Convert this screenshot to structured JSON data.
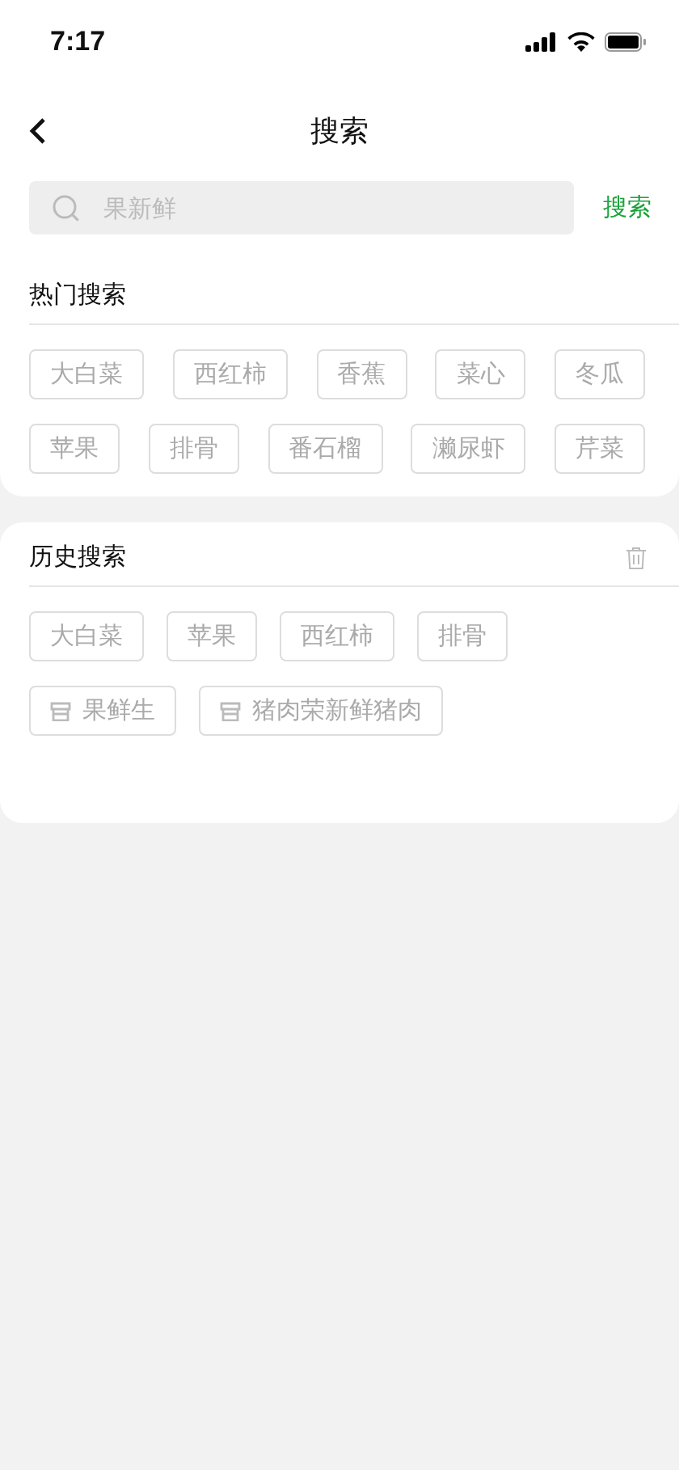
{
  "status_bar": {
    "time": "7:17"
  },
  "header": {
    "title": "搜索"
  },
  "search": {
    "placeholder": "果新鲜",
    "button": "搜索"
  },
  "hot_search": {
    "title": "热门搜索",
    "tags": [
      "大白菜",
      "西红柿",
      "香蕉",
      "菜心",
      "冬瓜",
      "苹果",
      "排骨",
      "番石榴",
      "濑尿虾",
      "芹菜"
    ]
  },
  "history_search": {
    "title": "历史搜索",
    "tags": [
      {
        "kind": "keyword",
        "label": "大白菜"
      },
      {
        "kind": "keyword",
        "label": "苹果"
      },
      {
        "kind": "keyword",
        "label": "西红柿"
      },
      {
        "kind": "keyword",
        "label": "排骨"
      },
      {
        "kind": "shop",
        "label": "果鲜生"
      },
      {
        "kind": "shop",
        "label": "猪肉荣新鲜猪肉"
      }
    ]
  }
}
